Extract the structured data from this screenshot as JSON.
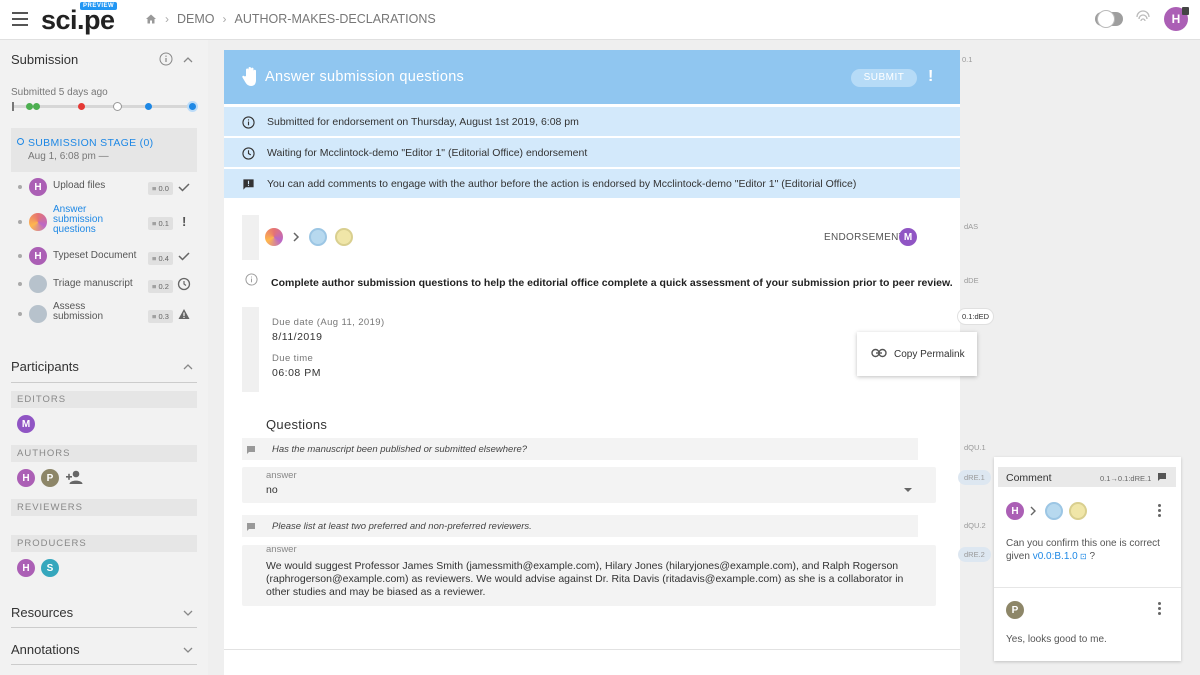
{
  "header": {
    "logo": "sci.pe",
    "logo_badge": "PREVIEW",
    "breadcrumbs": [
      "DEMO",
      "AUTHOR-MAKES-DECLARATIONS"
    ],
    "user_initial": "H"
  },
  "sidebar": {
    "submission_title": "Submission",
    "submitted_text": "Submitted 5 days ago",
    "stage_title": "SUBMISSION STAGE (0)",
    "stage_date": "Aug 1, 6:08 pm —",
    "steps": [
      {
        "avatar": "H",
        "label": "Upload files",
        "version": "≡ 0.0",
        "status": "check"
      },
      {
        "avatar": "",
        "label": "Answer submission questions",
        "version": "≡ 0.1",
        "status": "alert",
        "active": true
      },
      {
        "avatar": "H",
        "label": "Typeset Document",
        "version": "≡ 0.4",
        "status": "check"
      },
      {
        "avatar": "",
        "label": "Triage manuscript",
        "version": "≡ 0.2",
        "status": "clock"
      },
      {
        "avatar": "",
        "label": "Assess submission",
        "version": "≡ 0.3",
        "status": "warning"
      }
    ],
    "participants_title": "Participants",
    "roles": [
      "EDITORS",
      "AUTHORS",
      "REVIEWERS",
      "PRODUCERS"
    ],
    "editors": [
      "M"
    ],
    "authors": [
      "H",
      "P"
    ],
    "producers": [
      "H",
      "S"
    ],
    "resources_title": "Resources",
    "annotations_title": "Annotations"
  },
  "main": {
    "title": "Answer submission questions",
    "submit_label": "SUBMIT",
    "info_rows": [
      "Submitted for endorsement on Thursday, August 1st 2019, 6:08 pm",
      "Waiting for Mcclintock-demo \"Editor 1\" (Editorial Office) endorsement",
      "You can add comments to engage with the author before the action is endorsed by Mcclintock-demo \"Editor 1\" (Editorial Office)"
    ],
    "endorsement_label": "ENDORSEMENT",
    "endorser_initial": "M",
    "instructions": "Complete author submission questions to help the editorial office complete a quick assessment of your submission prior to peer review.",
    "due_date_label": "Due date (Aug 11, 2019)",
    "due_date_value": "8/11/2019",
    "due_time_label": "Due time",
    "due_time_value": "06:08 PM",
    "questions_title": "Questions",
    "questions": [
      {
        "text": "Has the manuscript been published or submitted elsewhere?",
        "answer_label": "answer",
        "answer": "no"
      },
      {
        "text": "Please list at least two preferred and non-preferred reviewers.",
        "answer_label": "answer",
        "answer": "We would suggest Professor James Smith (jamessmith@example.com), Hilary Jones (hilaryjones@example.com), and Ralph Rogerson (raphrogerson@example.com) as reviewers. We would advise against Dr. Rita Davis (ritadavis@example.com) as she is a collaborator in other studies and may be biased as a reviewer."
      }
    ]
  },
  "permalink_menu": {
    "label": "Copy Permalink"
  },
  "right_rail": {
    "tags": [
      "0.1",
      "dAS",
      "dDE",
      "dQU.1",
      "dQU.2"
    ],
    "pills": [
      "dRE.1",
      "dRE.2"
    ],
    "permalink_pill": "0.1:dED"
  },
  "comment_panel": {
    "title": "Comment",
    "ref": "0.1→0.1:dRE.1",
    "comments": [
      {
        "avatar": "H",
        "text_before": "Can you confirm this one is correct given",
        "link": "v0.0:B.1.0",
        "text_after": "?"
      },
      {
        "avatar": "P",
        "text": "Yes, looks good to me."
      }
    ]
  },
  "colors": {
    "header_blue": "#90c6f0",
    "info_blue": "#d3e9fb",
    "link_blue": "#1e88e5",
    "avatar_h": "#ab5fb5",
    "avatar_p": "#8d8668",
    "avatar_m": "#9055c4",
    "avatar_s": "#35a7bd"
  }
}
